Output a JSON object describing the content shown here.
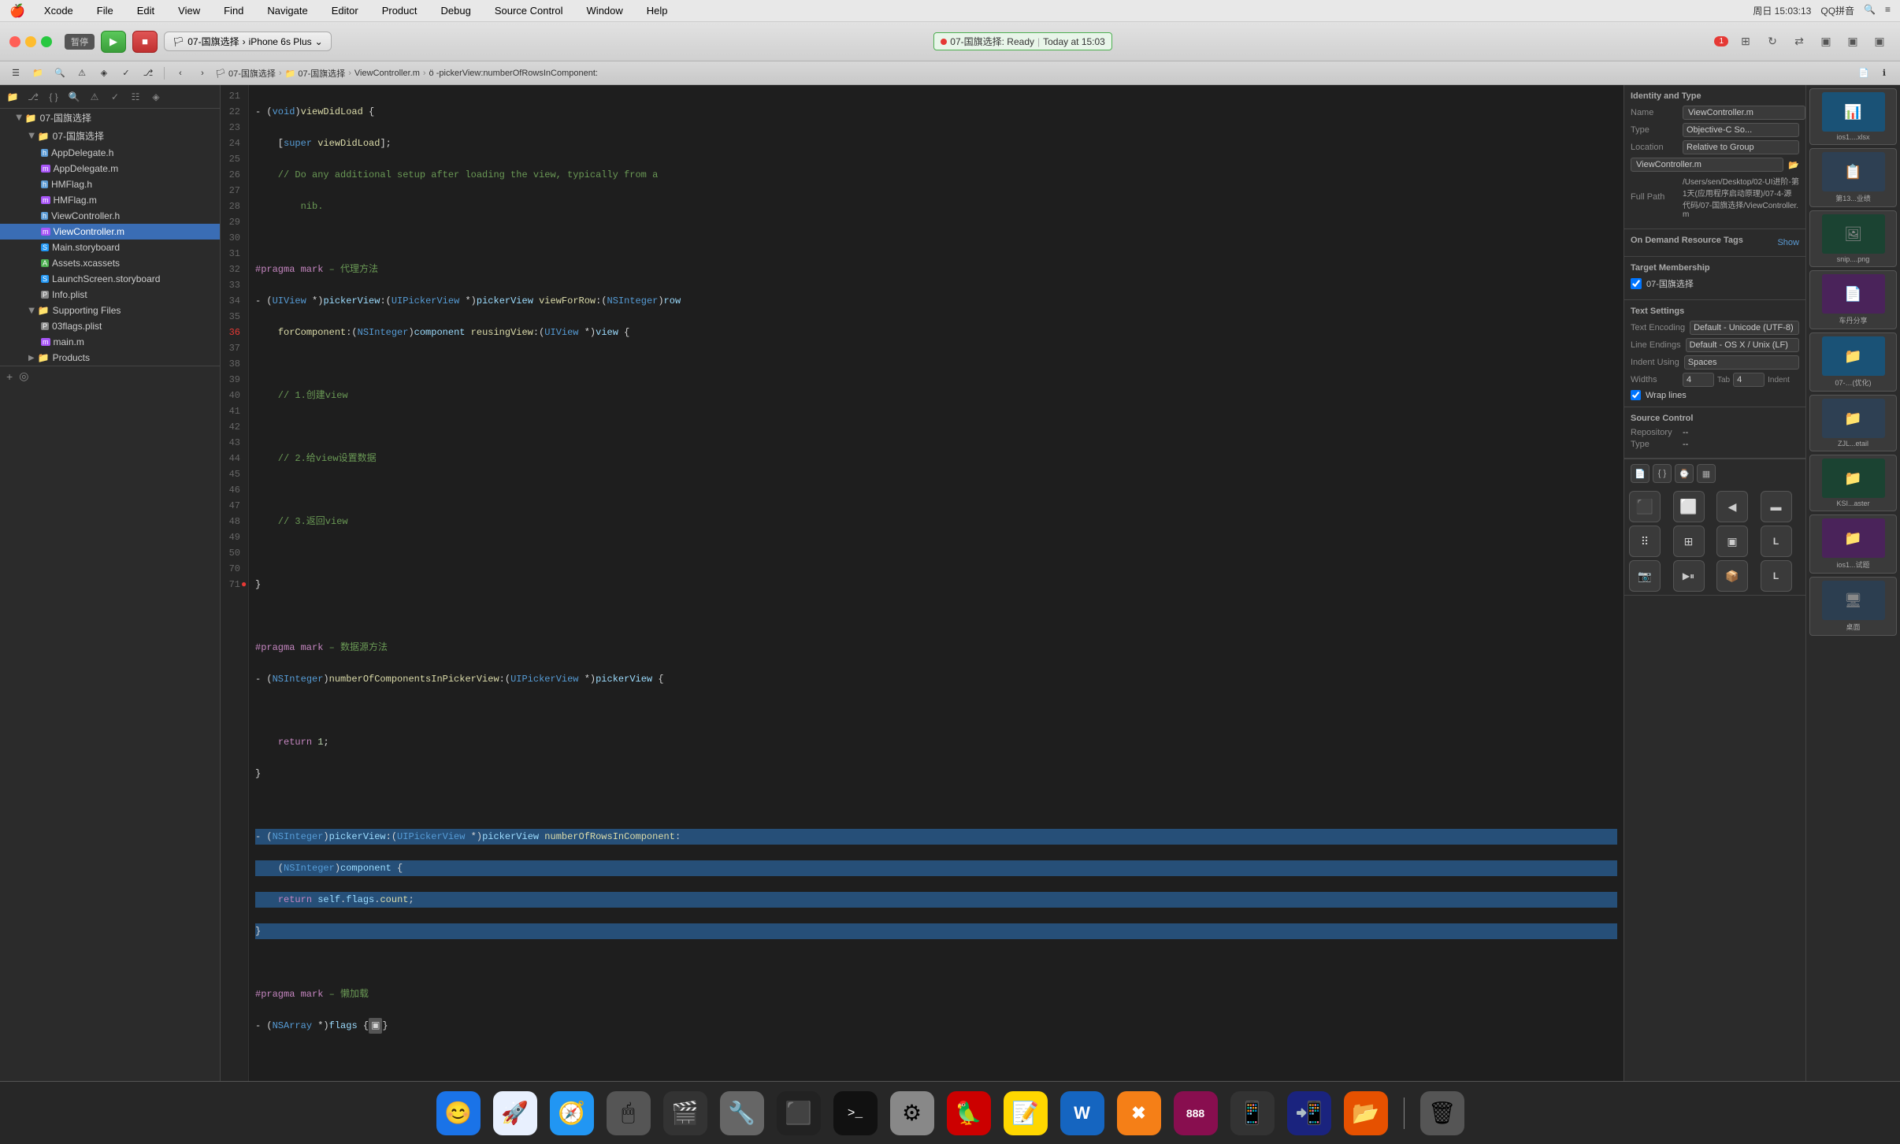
{
  "menubar": {
    "apple": "🍎",
    "items": [
      "Xcode",
      "File",
      "Edit",
      "View",
      "Find",
      "Navigate",
      "Editor",
      "Product",
      "Debug",
      "Source Control",
      "Window",
      "Help"
    ],
    "right_info": "周日 15:03:13",
    "qq_label": "QQ拼音"
  },
  "toolbar": {
    "scheme": "07-国旗选择",
    "device": "iPhone 6s Plus",
    "status_project": "07-国旗选择: Ready",
    "status_time": "Today at 15:03",
    "error_count": "1",
    "pause_label": "暂停"
  },
  "breadcrumb": {
    "parts": [
      "07-国旗选择",
      "07-国旗选择",
      "ViewController.m",
      "ö -pickerView:numberOfRowsInComponent:"
    ]
  },
  "sidebar": {
    "root": "07-国旗选择",
    "items": [
      {
        "level": 1,
        "label": "07-国旗选择",
        "type": "folder",
        "expanded": true
      },
      {
        "level": 2,
        "label": "AppDelegate.h",
        "type": "h"
      },
      {
        "level": 2,
        "label": "AppDelegate.m",
        "type": "m"
      },
      {
        "level": 2,
        "label": "HMFlag.h",
        "type": "h"
      },
      {
        "level": 2,
        "label": "HMFlag.m",
        "type": "m"
      },
      {
        "level": 2,
        "label": "ViewController.h",
        "type": "h"
      },
      {
        "level": 2,
        "label": "ViewController.m",
        "type": "m",
        "selected": true
      },
      {
        "level": 2,
        "label": "Main.storyboard",
        "type": "storyboard"
      },
      {
        "level": 2,
        "label": "Assets.xcassets",
        "type": "xcassets"
      },
      {
        "level": 2,
        "label": "LaunchScreen.storyboard",
        "type": "storyboard"
      },
      {
        "level": 2,
        "label": "Info.plist",
        "type": "plist"
      },
      {
        "level": 1,
        "label": "Supporting Files",
        "type": "folder",
        "expanded": true
      },
      {
        "level": 2,
        "label": "03flags.plist",
        "type": "plist"
      },
      {
        "level": 2,
        "label": "main.m",
        "type": "m"
      },
      {
        "level": 1,
        "label": "Products",
        "type": "folder",
        "expanded": false
      }
    ]
  },
  "code": {
    "lines": [
      {
        "num": 21,
        "content": "- (void)viewDidLoad {",
        "tokens": [
          {
            "t": "-",
            "c": "punc"
          },
          {
            "t": " (",
            "c": "punc"
          },
          {
            "t": "void",
            "c": "kw2"
          },
          {
            "t": ")",
            "c": "punc"
          },
          {
            "t": "viewDidLoad",
            "c": "fn"
          },
          {
            "t": " {",
            "c": "punc"
          }
        ]
      },
      {
        "num": 22,
        "content": "    [super viewDidLoad];",
        "indent": "    ",
        "tokens": [
          {
            "t": "[",
            "c": "punc"
          },
          {
            "t": "super",
            "c": "kw2"
          },
          {
            "t": " ",
            "c": ""
          },
          {
            "t": "viewDidLoad",
            "c": "fn"
          },
          {
            "t": "];",
            "c": "punc"
          }
        ]
      },
      {
        "num": 23,
        "content": "    // Do any additional setup after loading the view, typically from a",
        "tokens": [
          {
            "t": "    // Do any additional setup after loading the view, typically from a",
            "c": "cmt"
          }
        ]
      },
      {
        "num": 24,
        "content": "        nib.",
        "tokens": [
          {
            "t": "        nib.",
            "c": "cmt"
          }
        ]
      },
      {
        "num": 25,
        "content": ""
      },
      {
        "num": 26,
        "content": "#pragma mark - 代理方法",
        "tokens": [
          {
            "t": "#pragma mark",
            "c": "pragma"
          },
          {
            "t": " - 代理方法",
            "c": "cmt"
          }
        ]
      },
      {
        "num": 27,
        "content": "- (UIView *)pickerView:(UIPickerView *)pickerView viewForRow:(NSInteger)row",
        "tokens": []
      },
      {
        "num": 28,
        "content": "    forComponent:(NSInteger)component reusingView:(UIView *)view {",
        "tokens": []
      },
      {
        "num": 29,
        "content": ""
      },
      {
        "num": 30,
        "content": "    // 1.创建view",
        "tokens": [
          {
            "t": "    // 1.创建view",
            "c": "cmt"
          }
        ]
      },
      {
        "num": 31,
        "content": ""
      },
      {
        "num": 32,
        "content": "    // 2.给view设置数据",
        "tokens": [
          {
            "t": "    // 2.给view设置数据",
            "c": "cmt"
          }
        ]
      },
      {
        "num": 33,
        "content": ""
      },
      {
        "num": 34,
        "content": "    // 3.返回view",
        "tokens": [
          {
            "t": "    // 3.返回view",
            "c": "cmt"
          }
        ]
      },
      {
        "num": 35,
        "content": ""
      },
      {
        "num": 36,
        "content": "}",
        "error": true
      },
      {
        "num": 37,
        "content": ""
      },
      {
        "num": 38,
        "content": "#pragma mark - 数据源方法",
        "tokens": [
          {
            "t": "#pragma mark",
            "c": "pragma"
          },
          {
            "t": " - 数据源方法",
            "c": "cmt"
          }
        ]
      },
      {
        "num": 39,
        "content": "- (NSInteger)numberOfComponentsInPickerView:(UIPickerView *)pickerView {",
        "tokens": []
      },
      {
        "num": 40,
        "content": ""
      },
      {
        "num": 41,
        "content": "    return 1;",
        "tokens": [
          {
            "t": "    ",
            "c": ""
          },
          {
            "t": "return",
            "c": "kw"
          },
          {
            "t": " ",
            "c": ""
          },
          {
            "t": "1",
            "c": "num"
          },
          {
            "t": ";",
            "c": "punc"
          }
        ]
      },
      {
        "num": 42,
        "content": "}"
      },
      {
        "num": 43,
        "content": ""
      },
      {
        "num": 44,
        "content": "- (NSInteger)pickerView:(UIPickerView *)pickerView numberOfRowsInComponent:",
        "highlighted": true
      },
      {
        "num": 45,
        "content": "    (NSInteger)component {",
        "highlighted": true
      },
      {
        "num": 46,
        "content": "    return self.flags.count;",
        "highlighted": true
      },
      {
        "num": 47,
        "content": "}",
        "highlighted": true
      },
      {
        "num": 48,
        "content": ""
      },
      {
        "num": 49,
        "content": "#pragma mark - 懒加载",
        "tokens": [
          {
            "t": "#pragma mark",
            "c": "pragma"
          },
          {
            "t": " - 懒加载",
            "c": "cmt"
          }
        ]
      },
      {
        "num": 50,
        "content": "- (NSArray *)flags {▣}",
        "tokens": []
      },
      {
        "num": 70,
        "content": ""
      },
      {
        "num": 71,
        "content": ""
      }
    ]
  },
  "right_panel": {
    "identity_type_title": "Identity and Type",
    "name_label": "Name",
    "name_value": "ViewController.m",
    "type_label": "Type",
    "type_value": "Objective-C So...",
    "location_label": "Location",
    "location_value": "Relative to Group",
    "filename_value": "ViewController.m",
    "full_path_label": "Full Path",
    "full_path_value": "/Users/sen/Desktop/02-UI进阶-第1天(应用程序启动原理)/07-4-源代码/07-国旗选择/ViewController.m",
    "on_demand_title": "On Demand Resource Tags",
    "on_demand_show": "Show",
    "target_title": "Target Membership",
    "target_checkbox": true,
    "target_label": "07-国旗选择",
    "text_settings_title": "Text Settings",
    "encoding_label": "Text Encoding",
    "encoding_value": "Default - Unicode (UTF-8)",
    "line_endings_label": "Line Endings",
    "line_endings_value": "Default - OS X / Unix (LF)",
    "indent_label": "Indent Using",
    "indent_value": "Spaces",
    "widths_label": "Widths",
    "tab_width": "4",
    "indent_width": "4",
    "tab_label": "Tab",
    "indent_label2": "Indent",
    "wrap_lines_label": "Wrap lines",
    "source_control_title": "Source Control",
    "repository_label": "Repository",
    "repository_value": "--",
    "type_sc_label": "Type",
    "type_sc_value": "--"
  },
  "far_right": {
    "files": [
      {
        "label": "ios1....xlsx",
        "icon": "📊",
        "color": "#1a5276"
      },
      {
        "label": "第13...业绩",
        "icon": "📋",
        "color": "#2e4053"
      },
      {
        "label": "snip....png",
        "icon": "🖼",
        "color": "#1b4332"
      },
      {
        "label": "车丹分享",
        "icon": "📄",
        "color": "#4a235a"
      },
      {
        "label": "07-…(优化)",
        "icon": "📁",
        "color": "#1a5276"
      },
      {
        "label": "ZJL...etail",
        "icon": "📁",
        "color": "#2e4053"
      },
      {
        "label": "KSI...aster",
        "icon": "📁",
        "color": "#1b4332"
      },
      {
        "label": "ios1...试题",
        "icon": "📁",
        "color": "#4a235a"
      },
      {
        "label": "桌面",
        "icon": "🖥",
        "color": "#2c3e50"
      }
    ],
    "icon_grid": [
      {
        "icon": "⬛",
        "label": ""
      },
      {
        "icon": "⬜",
        "label": ""
      },
      {
        "icon": "◀",
        "label": ""
      },
      {
        "icon": "▬",
        "label": ""
      },
      {
        "icon": "⠿",
        "label": ""
      },
      {
        "icon": "▬",
        "label": ""
      },
      {
        "icon": "⬛",
        "label": ""
      },
      {
        "icon": "L",
        "label": ""
      },
      {
        "icon": "📷",
        "label": ""
      },
      {
        "icon": "▶⏸",
        "label": ""
      },
      {
        "icon": "📦",
        "label": ""
      },
      {
        "icon": "L",
        "label": ""
      }
    ]
  },
  "dock": {
    "items": [
      {
        "label": "Finder",
        "icon": "😊",
        "bg": "#1a73e8"
      },
      {
        "label": "Launchpad",
        "icon": "🚀",
        "bg": "#e8e8e8"
      },
      {
        "label": "Safari",
        "icon": "🧭",
        "bg": "#2196f3"
      },
      {
        "label": "Mouse",
        "icon": "🖱",
        "bg": "#555"
      },
      {
        "label": "Movie",
        "icon": "🎬",
        "bg": "#333"
      },
      {
        "label": "Tools",
        "icon": "🔧",
        "bg": "#666"
      },
      {
        "label": "Script",
        "icon": "⬛",
        "bg": "#222"
      },
      {
        "label": "Terminal",
        "icon": ">_",
        "bg": "#111"
      },
      {
        "label": "Prefs",
        "icon": "⚙",
        "bg": "#888"
      },
      {
        "label": "Parrot",
        "icon": "🦜",
        "bg": "#c00"
      },
      {
        "label": "Notes",
        "icon": "📝",
        "bg": "#ffd700"
      },
      {
        "label": "Word",
        "icon": "W",
        "bg": "#1565c0"
      },
      {
        "label": "X",
        "icon": "✖",
        "bg": "#f57f17"
      },
      {
        "label": "888",
        "icon": "888",
        "bg": "#880e4f"
      },
      {
        "label": "Remote",
        "icon": "📱",
        "bg": "#333"
      },
      {
        "label": "Emu",
        "icon": "📲",
        "bg": "#1a237e"
      },
      {
        "label": "File",
        "icon": "📂",
        "bg": "#e65100"
      },
      {
        "label": "Trash",
        "icon": "🗑",
        "bg": "#555"
      }
    ]
  }
}
